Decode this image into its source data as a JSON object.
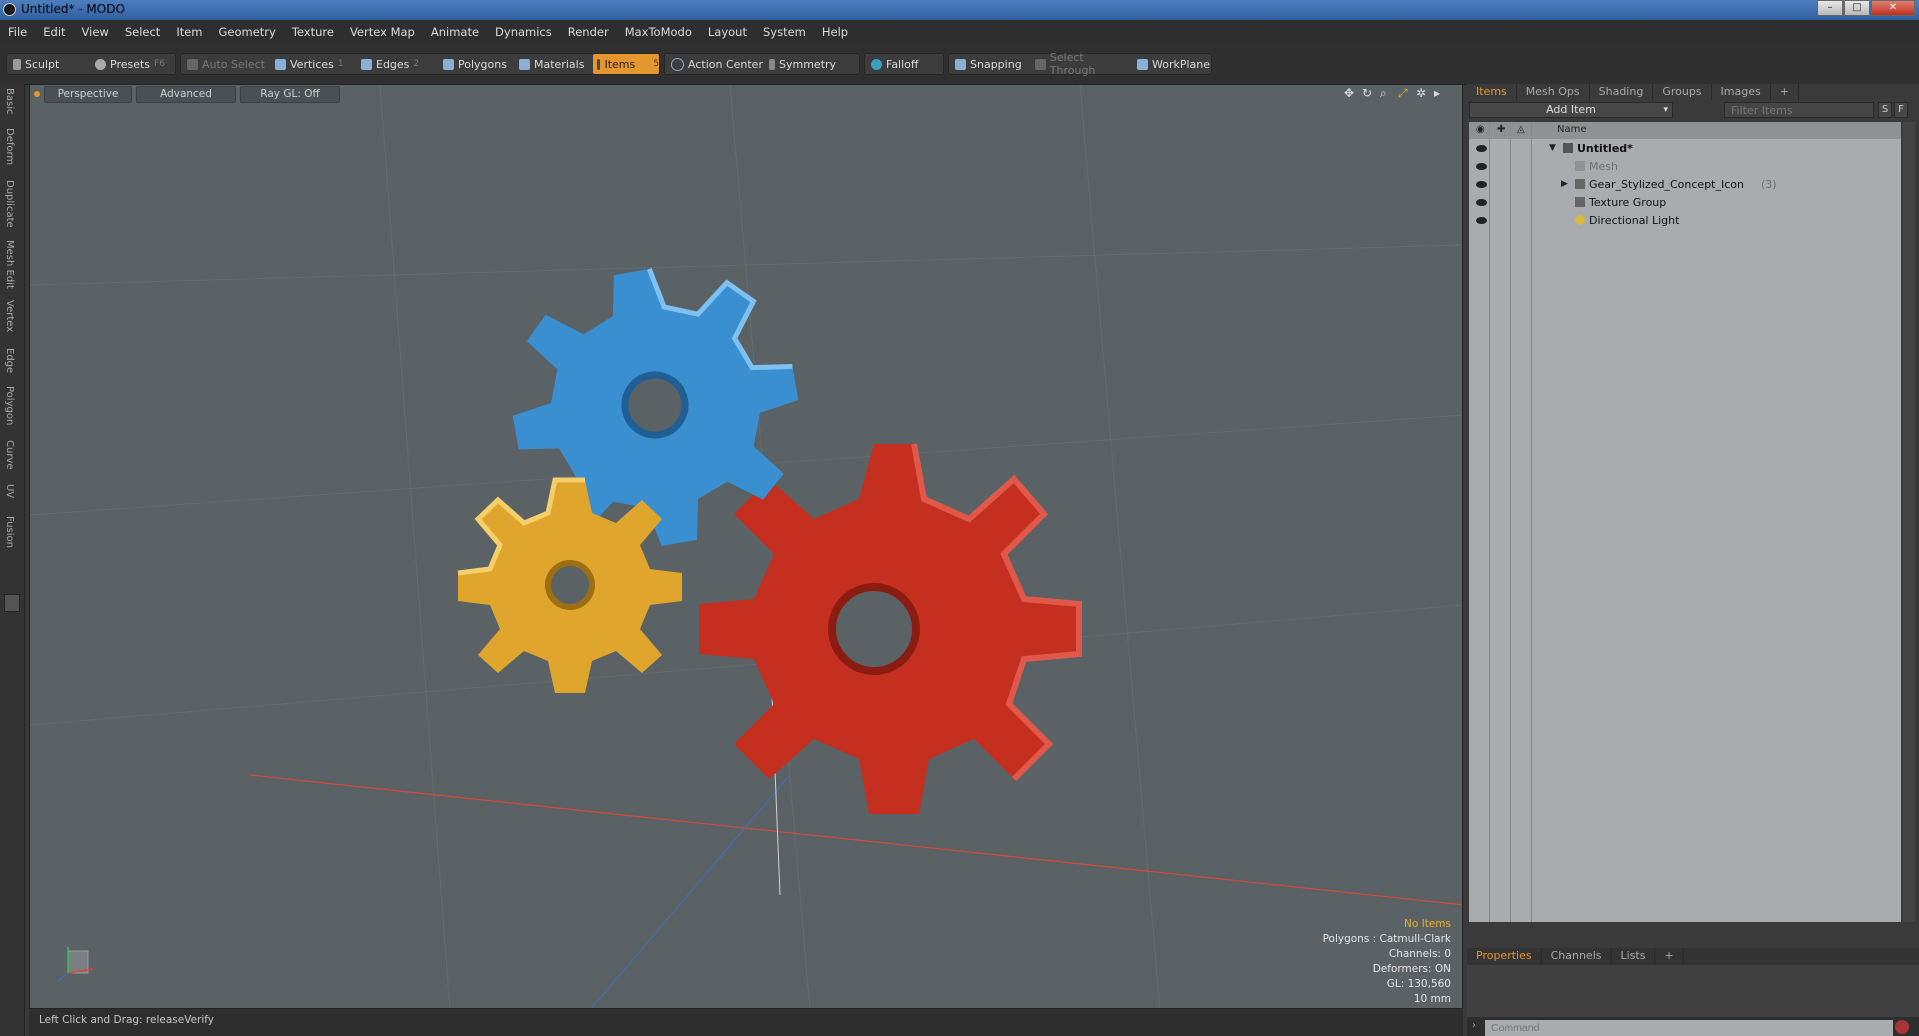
{
  "window": {
    "title": "Untitled* - MODO",
    "minimize": "–",
    "maximize": "□",
    "close": "✕"
  },
  "menu": [
    "File",
    "Edit",
    "View",
    "Select",
    "Item",
    "Geometry",
    "Texture",
    "Vertex Map",
    "Animate",
    "Dynamics",
    "Render",
    "MaxToModo",
    "Layout",
    "System",
    "Help"
  ],
  "toolbar": {
    "sculpt": "Sculpt",
    "presets": "Presets",
    "presets_key": "F6",
    "auto_select": "Auto Select",
    "vertices": "Vertices",
    "vertices_key": "1",
    "edges": "Edges",
    "edges_key": "2",
    "polygons": "Polygons",
    "materials": "Materials",
    "items": "Items",
    "items_key": "5",
    "action_center": "Action Center",
    "symmetry": "Symmetry",
    "falloff": "Falloff",
    "snapping": "Snapping",
    "select_through": "Select Through",
    "workplane": "WorkPlane"
  },
  "left_tabs": [
    "Basic",
    "Deform",
    "Duplicate",
    "Mesh Edit",
    "Vertex",
    "Edge",
    "Polygon",
    "Curve",
    "UV",
    "Fusion"
  ],
  "viewport": {
    "tabs": [
      "Perspective",
      "Advanced",
      "Ray GL: Off"
    ],
    "icons": [
      "move-view-icon",
      "rotate-view-icon",
      "zoom-view-icon",
      "maximize-view-icon",
      "settings-icon",
      "arrow-right-icon"
    ],
    "info": {
      "selection": "No Items",
      "polygons": "Polygons : Catmull-Clark",
      "channels": "Channels: 0",
      "deformers": "Deformers: ON",
      "gl": "GL: 130,560",
      "scale": "10 mm"
    },
    "gears": {
      "blue": "#3a8fd0",
      "red": "#c42f20",
      "yellow": "#e0a52c",
      "background": "#5a6266",
      "axis_x": "#d44a3a",
      "axis_z": "#4a6ab0"
    }
  },
  "status": {
    "text": "Left Click and Drag:  releaseVerify"
  },
  "items_panel": {
    "tabs": [
      "Items",
      "Mesh Ops",
      "Shading",
      "Groups",
      "Images",
      "+"
    ],
    "add_item": "Add Item",
    "filter_placeholder": "Filter Items",
    "btn_s": "S",
    "btn_f": "F",
    "col_name": "Name",
    "rows": [
      {
        "label": "Untitled*",
        "bold": true
      },
      {
        "label": "Mesh",
        "dim": true
      },
      {
        "label": "Gear_Stylized_Concept_Icon",
        "count": "(3)"
      },
      {
        "label": "Texture Group"
      },
      {
        "label": "Directional Light"
      }
    ]
  },
  "properties_panel": {
    "tabs": [
      "Properties",
      "Channels",
      "Lists",
      "+"
    ],
    "command_placeholder": "Command"
  }
}
